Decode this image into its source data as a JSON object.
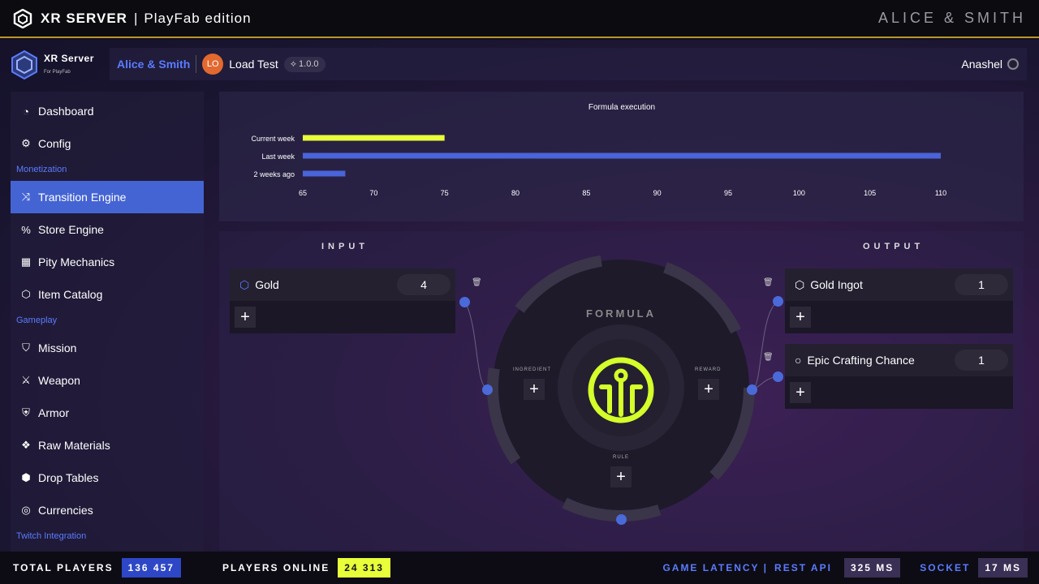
{
  "topbar": {
    "title": "XR SERVER",
    "separator": "|",
    "edition": "PlayFab edition",
    "brand": "ALICE & SMITH"
  },
  "app": {
    "name": "XR Server",
    "subtitle": "For PlayFab"
  },
  "breadcrumb": {
    "org": "Alice & Smith",
    "avatar_initials": "LO",
    "project": "Load Test",
    "version": "1.0.0"
  },
  "user": {
    "name": "Anashel"
  },
  "sidebar": {
    "items": [
      {
        "label": "Dashboard",
        "icon": "pie-icon",
        "glyph": "◔"
      },
      {
        "label": "Config",
        "icon": "gear-icon",
        "glyph": "⚙"
      },
      {
        "section": "Monetization"
      },
      {
        "label": "Transition Engine",
        "icon": "shuffle-icon",
        "glyph": "⤨",
        "active": true
      },
      {
        "label": "Store Engine",
        "icon": "percent-icon",
        "glyph": "%"
      },
      {
        "label": "Pity Mechanics",
        "icon": "pity-icon",
        "glyph": "▦"
      },
      {
        "label": "Item Catalog",
        "icon": "cube-icon",
        "glyph": "⬡"
      },
      {
        "section": "Gameplay"
      },
      {
        "label": "Mission",
        "icon": "shield-icon",
        "glyph": "⛉"
      },
      {
        "label": "Weapon",
        "icon": "sword-icon",
        "glyph": "⚔"
      },
      {
        "label": "Armor",
        "icon": "armor-icon",
        "glyph": "⛨"
      },
      {
        "label": "Raw Materials",
        "icon": "materials-icon",
        "glyph": "❖"
      },
      {
        "label": "Drop Tables",
        "icon": "drop-tables-icon",
        "glyph": "⬢"
      },
      {
        "label": "Currencies",
        "icon": "coins-icon",
        "glyph": "◎"
      },
      {
        "section": "Twitch Integration"
      }
    ]
  },
  "chart_data": {
    "type": "bar",
    "orientation": "horizontal",
    "title": "Formula execution",
    "categories": [
      "Current week",
      "Last week",
      "2 weeks ago"
    ],
    "values": [
      75,
      110,
      68
    ],
    "colors": [
      "#e8ff3a",
      "#4a64d9",
      "#4a64d9"
    ],
    "xlim": [
      65,
      110
    ],
    "ticks": [
      65,
      70,
      75,
      80,
      85,
      90,
      95,
      100,
      105,
      110
    ]
  },
  "formula": {
    "input_title": "INPUT",
    "output_title": "OUTPUT",
    "center_title": "FORMULA",
    "ingredient_label": "INGREDIENT",
    "reward_label": "REWARD",
    "rule_label": "RULE",
    "inputs": [
      {
        "name": "Gold",
        "qty": "4"
      }
    ],
    "outputs": [
      {
        "name": "Gold Ingot",
        "qty": "1"
      },
      {
        "name": "Epic Crafting Chance",
        "qty": "1"
      }
    ],
    "add_symbol": "+",
    "accent": "#d4ff2a"
  },
  "bottombar": {
    "total_players_label": "TOTAL PLAYERS",
    "total_players": "136 457",
    "players_online_label": "PLAYERS ONLINE",
    "players_online": "24 313",
    "latency_label": "GAME LATENCY |",
    "rest_label": "REST API",
    "rest_value": "325 MS",
    "socket_label": "SOCKET",
    "socket_value": "17 MS"
  }
}
